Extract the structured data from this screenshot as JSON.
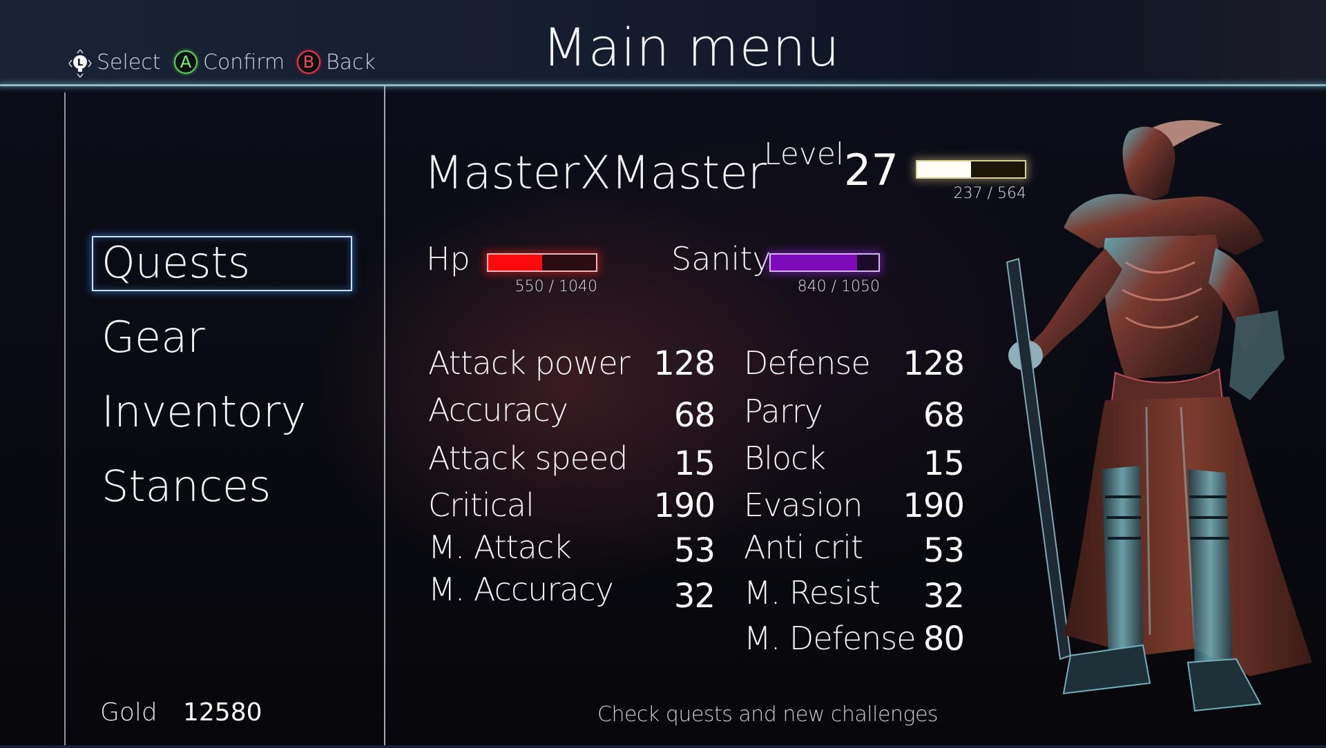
{
  "header": {
    "title": "Main menu",
    "hints": [
      {
        "icon": "left-stick-icon",
        "glyph": "L",
        "label": "Select"
      },
      {
        "icon": "a-button-icon",
        "glyph": "A",
        "label": "Confirm"
      },
      {
        "icon": "b-button-icon",
        "glyph": "B",
        "label": "Back"
      }
    ]
  },
  "sidebar": {
    "items": [
      {
        "label": "Quests",
        "selected": true
      },
      {
        "label": "Gear",
        "selected": false
      },
      {
        "label": "Inventory",
        "selected": false
      },
      {
        "label": "Stances",
        "selected": false
      }
    ],
    "gold_label": "Gold",
    "gold_value": "12580"
  },
  "character": {
    "name": "MasterXMaster",
    "level_label": "Level",
    "level": "27",
    "xp": {
      "current": 237,
      "max": 564,
      "text": "237 / 564",
      "fill_fraction": 0.5
    },
    "hp": {
      "label": "Hp",
      "current": 550,
      "max": 1040,
      "text": "550 / 1040",
      "fill_fraction": 0.5
    },
    "sanity": {
      "label": "Sanity",
      "current": 840,
      "max": 1050,
      "text": "840 / 1050",
      "fill_fraction": 0.8
    }
  },
  "stats": {
    "left": [
      {
        "label": "Attack power",
        "value": "128"
      },
      {
        "label": "Accuracy",
        "value": "68"
      },
      {
        "label": "Attack speed",
        "value": "15"
      },
      {
        "label": "Critical",
        "value": "190"
      },
      {
        "label": "M. Attack",
        "value": "53"
      },
      {
        "label": "M. Accuracy",
        "value": "32"
      }
    ],
    "right": [
      {
        "label": "Defense",
        "value": "128"
      },
      {
        "label": "Parry",
        "value": "68"
      },
      {
        "label": "Block",
        "value": "15"
      },
      {
        "label": "Evasion",
        "value": "190"
      },
      {
        "label": "Anti crit",
        "value": "53"
      },
      {
        "label": "M. Resist",
        "value": "32"
      },
      {
        "label": "M. Defense",
        "value": "80"
      }
    ]
  },
  "footer": {
    "description": "Check quests and new challenges"
  },
  "colors": {
    "hp": "#ff0a0a",
    "sanity": "#7d0cb8",
    "xp": "#fffdf5",
    "confirm": "#5fd35a",
    "back": "#e23b4d",
    "header_line": "#8fb7c6"
  }
}
